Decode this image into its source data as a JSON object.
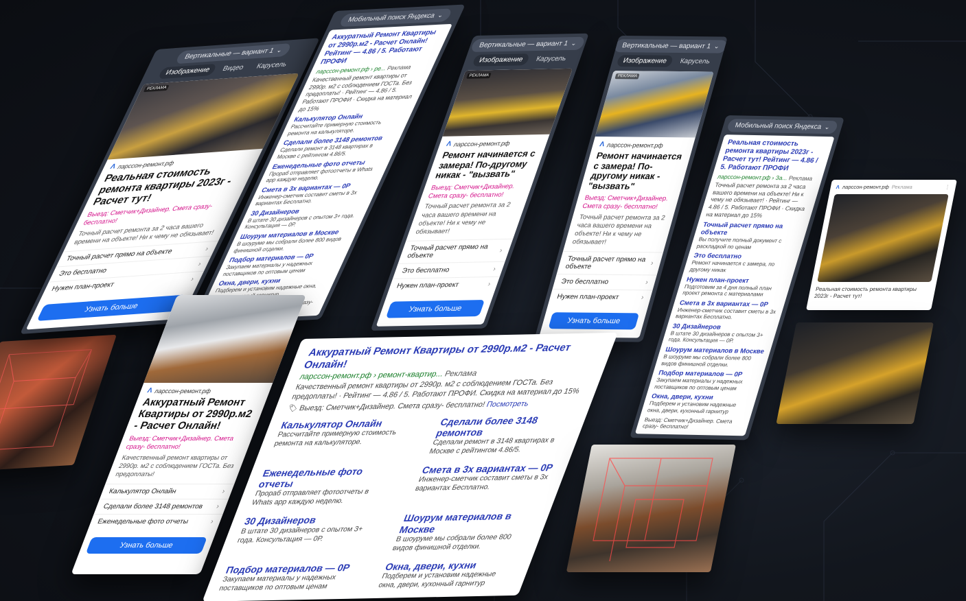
{
  "vertical_1": {
    "label": "Вертикальные — вариант 1"
  },
  "mobile_search": {
    "label": "Мобильный поиск Яндекса"
  },
  "tabs_a": [
    "Изображение",
    "Видео",
    "Карусель"
  ],
  "tabs_b": [
    "Изображение",
    "Карусель"
  ],
  "badge": "РЕКЛАМА",
  "domain": "ларссон-ремонт.рф",
  "ad_label": "Реклама",
  "more_button": "Узнать больше",
  "card_cost": {
    "title": "Реальная стоимость ремонта квартиры 2023г - Расчет тут!",
    "pink": "Выезд: Сметчик+Дизайнер. Смета сразу- бесплатно!",
    "desc": "Точный расчет ремонта за 2 часа вашего времени на объекте! Ни к чему не обязывает!",
    "links": [
      "Точный расчет прямо на объекте",
      "Это бесплатно",
      "Нужен план-проект"
    ]
  },
  "card_measure": {
    "title": "Ремонт начинается с замера! По-другому никак - \"вызвать\"",
    "pink": "Выезд: Сметчик+Дизайнер. Смета сразу- бесплатно!",
    "desc": "Точный расчет ремонта за 2 часа вашего времени на объекте! Ни к чему не обязывает!",
    "links": [
      "Точный расчет прямо на объекте",
      "Это бесплатно",
      "Нужен план-проект"
    ]
  },
  "card_price": {
    "title": "Аккуратный Ремонт Квартиры от 2990р.м2 - Расчет Онлайн!",
    "pink": "Выезд: Сметчик+Дизайнер. Смета сразу- бесплатно!",
    "desc": "Качественный ремонт квартиры от 2990р. м2 с соблюдением ГОСТа. Без предоплаты!",
    "links": [
      "Калькулятор Онлайн",
      "Сделали более 3148 ремонтов",
      "Еженедельные фото отчеты"
    ]
  },
  "search_1": {
    "title": "Аккуратный Ремонт Квартиры от 2990р.м2 - Расчет Онлайн! Рейтинг — 4.86 / 5. Работают ПРОФИ",
    "green": "ларссон-ремонт.рф › ре...",
    "desc": "Качественный ремонт квартиры от 2990р. м2 с соблюдением ГОСТа. Без предоплаты! · Рейтинг — 4.86 / 5. Работают ПРОФИ · Скидка на материал до 15%",
    "sitelinks": [
      {
        "t": "Калькулятор Онлайн",
        "d": "Рассчитайте примерную стоимость ремонта на калькуляторе."
      },
      {
        "t": "Сделали более 3148 ремонтов",
        "d": "Сделали ремонт в 3148 квартирах в Москве с рейтингом 4.86/5."
      },
      {
        "t": "Еженедельные фото отчеты",
        "d": "Прораб отправляет фотоотчеты в Whats app каждую неделю."
      },
      {
        "t": "Смета в 3х вариантах — 0Р",
        "d": "Инженер-сметчик составит сметы в 3х вариантах Бесплатно."
      },
      {
        "t": "30 Дизайнеров",
        "d": "В штате 30 дизайнеров с опытом 3+ года. Консультация — 0Р."
      },
      {
        "t": "Шоурум материалов в Москве",
        "d": "В шоуруме мы собрали более 800 видов финишной отделки."
      },
      {
        "t": "Подбор материалов — 0Р",
        "d": "Закупаем материалы у надежных поставщиков по оптовым ценам"
      },
      {
        "t": "Окна, двери, кухни",
        "d": "Подберем и установим надежные окна, двери, кухонный гарнитур"
      }
    ],
    "foot": "Выезд: Сметчик+Дизайнер. Смета сразу- бесплатно!"
  },
  "search_2": {
    "title": "Реальная стоимость ремонта квартиры 2023г - Расчет тут! Рейтинг — 4.86 / 5. Работают ПРОФИ",
    "green": "ларссон-ремонт.рф › За...",
    "desc": "Точный расчет ремонта за 2 часа вашего времени на объекте! Ни к чему не обязывает! · Рейтинг — 4.86 / 5. Работают ПРОФИ · Скидка на материал до 15%",
    "sitelinks": [
      {
        "t": "Точный расчет прямо на объекте",
        "d": "Вы получите полный документ с раскладкой по ценам"
      },
      {
        "t": "Это бесплатно",
        "d": "Ремонт начинается с замера, по другому никак"
      },
      {
        "t": "Нужен план-проект",
        "d": "Подготовим за 4 дня полный план проект ремонта с материалами"
      },
      {
        "t": "Смета в 3х вариантах — 0Р",
        "d": "Инженер-сметчик составит сметы в 3х вариантах Бесплатно."
      },
      {
        "t": "30 Дизайнеров",
        "d": "В штате 30 дизайнеров с опытом 3+ года. Консультация — 0Р."
      },
      {
        "t": "Шоурум материалов в Москве",
        "d": "В шоуруме мы собрали более 800 видов финишной отделки."
      },
      {
        "t": "Подбор материалов — 0Р",
        "d": "Закупаем материалы у надежных поставщиков по оптовым ценам"
      },
      {
        "t": "Окна, двери, кухни",
        "d": "Подберем и установим надежные окна, двери, кухонный гарнитур"
      }
    ],
    "foot": "Выезд: Сметчик+Дизайнер. Смета сразу- бесплатно!"
  },
  "big": {
    "title": "Аккуратный Ремонт Квартиры от 2990р.м2 - Расчет Онлайн!",
    "green": "ларссон-ремонт.рф › ремонт-квартир...",
    "desc": "Качественный ремонт квартиры от 2990р. м2 с соблюдением ГОСТа. Без предоплаты! · Рейтинг — 4.86 / 5. Работают ПРОФИ. Скидка на материал до 15%",
    "promo": "Выезд: Сметчик+Дизайнер. Смета сразу- бесплатно!",
    "more": "Посмотреть",
    "sitelinks": [
      {
        "t": "Калькулятор Онлайн",
        "d": "Рассчитайте примерную стоимость ремонта на калькуляторе."
      },
      {
        "t": "Сделали более 3148 ремонтов",
        "d": "Сделали ремонт в 3148 квартирах в Москве с рейтингом 4.86/5."
      },
      {
        "t": "Еженедельные фото отчеты",
        "d": "Прораб отправляет фотоотчеты в Whats app каждую неделю."
      },
      {
        "t": "Смета в 3х вариантах — 0Р",
        "d": "Инженер-сметчик составит сметы в 3х вариантах Бесплатно."
      },
      {
        "t": "30 Дизайнеров",
        "d": "В штате 30 дизайнеров с опытом 3+ года. Консультация — 0Р."
      },
      {
        "t": "Шоурум материалов в Москве",
        "d": "В шоуруме мы собрали более 800 видов финишной отделки."
      },
      {
        "t": "Подбор материалов — 0Р",
        "d": "Закупаем материалы у надежных поставщиков по оптовым ценам"
      },
      {
        "t": "Окна, двери, кухни",
        "d": "Подберем и установим надежные окна, двери, кухонный гарнитур"
      }
    ]
  },
  "image_ad": {
    "domain": "ларссон-ремонт.рф",
    "ad": "Реклама",
    "caption": "Реальная стоимость ремонта квартиры 2023г - Расчет тут!"
  },
  "colors": {
    "accent": "#1d6ef0",
    "link": "#2a3bb5",
    "pink": "#d4148b",
    "green": "#1a7f2a"
  }
}
